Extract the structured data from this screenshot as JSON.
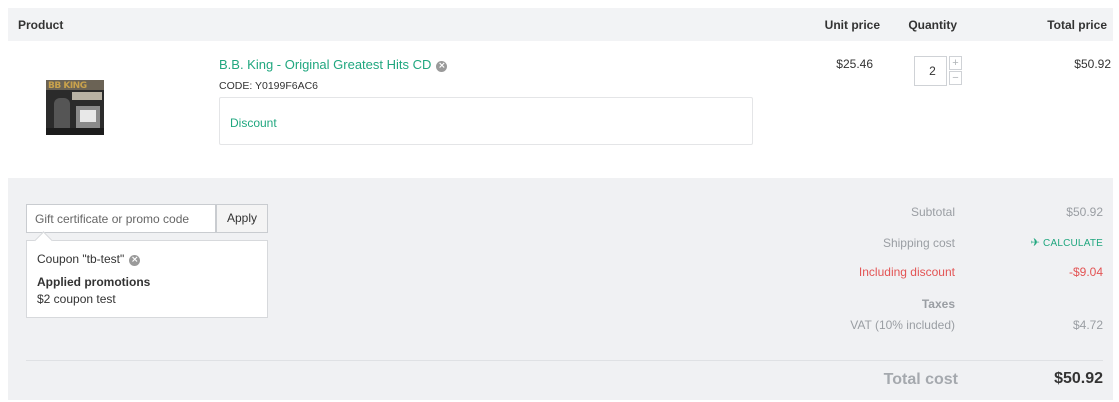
{
  "table": {
    "headers": {
      "product": "Product",
      "unit_price": "Unit price",
      "quantity": "Quantity",
      "total_price": "Total price"
    }
  },
  "item": {
    "name": "B.B. King - Original Greatest Hits CD",
    "code": "CODE: Y0199F6AC6",
    "thumbnail_text": "BB KING",
    "remove_icon": "×",
    "discount_label": "Discount",
    "unit_price": "$25.46",
    "quantity": "2",
    "qty_up": "+",
    "qty_down": "−",
    "total_price": "$50.92"
  },
  "promo": {
    "placeholder": "Gift certificate or promo code",
    "apply_label": "Apply",
    "coupon_text": "Coupon \"tb-test\"",
    "coupon_remove_icon": "×",
    "applied_title": "Applied promotions",
    "applied_item": "$2 coupon test"
  },
  "summary": {
    "subtotal_label": "Subtotal",
    "subtotal_value": "$50.92",
    "shipping_label": "Shipping cost",
    "shipping_action": "CALCULATE",
    "shipping_icon": "✈",
    "discount_label": "Including discount",
    "discount_value": "-$9.04",
    "taxes_label": "Taxes",
    "vat_label": "VAT (10% included)",
    "vat_value": "$4.72",
    "total_label": "Total cost",
    "total_value": "$50.92"
  },
  "colors": {
    "accent": "#20a77f",
    "discount": "#e35454",
    "panel_bg": "#f0f1f3",
    "header_bg": "#f2f3f5"
  }
}
